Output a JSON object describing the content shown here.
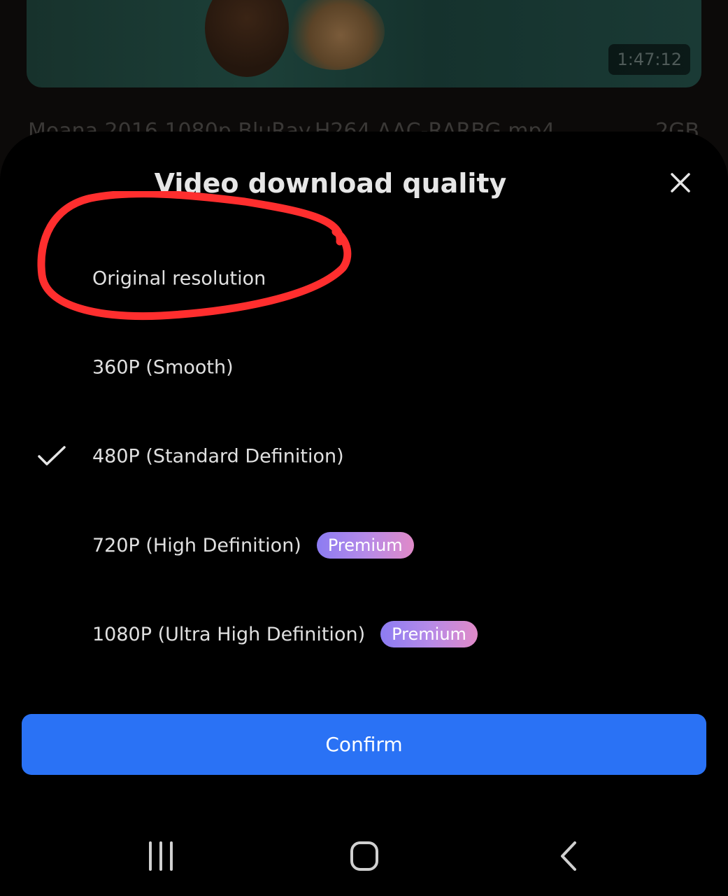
{
  "background": {
    "duration": "1:47:12",
    "filename": "Moana.2016.1080p.BluRay.H264.AAC-RARBG.mp4",
    "size": "2GB"
  },
  "sheet": {
    "title": "Video download quality",
    "close_icon": "close-icon",
    "options": [
      {
        "label": "Original resolution",
        "selected": false,
        "premium": false
      },
      {
        "label": "360P (Smooth)",
        "selected": false,
        "premium": false
      },
      {
        "label": "480P (Standard Definition)",
        "selected": true,
        "premium": false
      },
      {
        "label": "720P (High Definition)",
        "selected": false,
        "premium": true,
        "badge": "Premium"
      },
      {
        "label": "1080P (Ultra High Definition)",
        "selected": false,
        "premium": true,
        "badge": "Premium"
      }
    ],
    "confirm_label": "Confirm"
  },
  "navbar": {
    "items": [
      "recent-apps-icon",
      "home-icon",
      "back-icon"
    ]
  },
  "colors": {
    "accent": "#2a72f5",
    "annotation": "#ff2e2e",
    "premium_start": "#8c7cf2",
    "premium_end": "#e08ac8"
  }
}
